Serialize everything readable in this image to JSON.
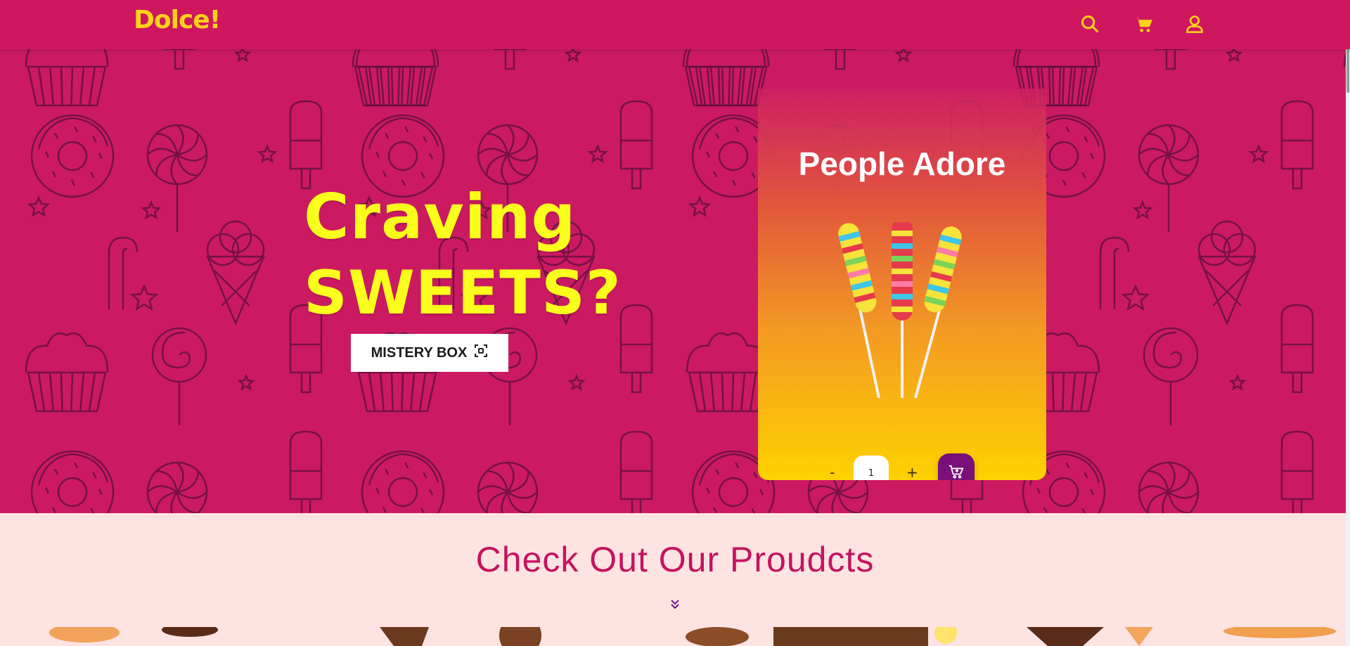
{
  "nav": {
    "brand": "Dolce!",
    "icons": [
      "search-icon",
      "cart-icon",
      "user-icon"
    ]
  },
  "hero": {
    "headline_line1": "Craving",
    "headline_line2": "SWEETS?",
    "cta_label": "MISTERY BOX"
  },
  "featured": {
    "title": "People Adore",
    "quantity": "1",
    "minus_label": "-",
    "plus_label": "+"
  },
  "products": {
    "title": "Check Out Our Proudcts"
  },
  "colors": {
    "nav_bg": "#cf1760",
    "hero_bg": "#cc1a62",
    "brand_yellow": "#ffd21a",
    "headline_yellow": "#fbff1c",
    "accent_purple": "#7a0f7a",
    "section_bg": "#fde3e1",
    "title_pink": "#c5135f"
  }
}
